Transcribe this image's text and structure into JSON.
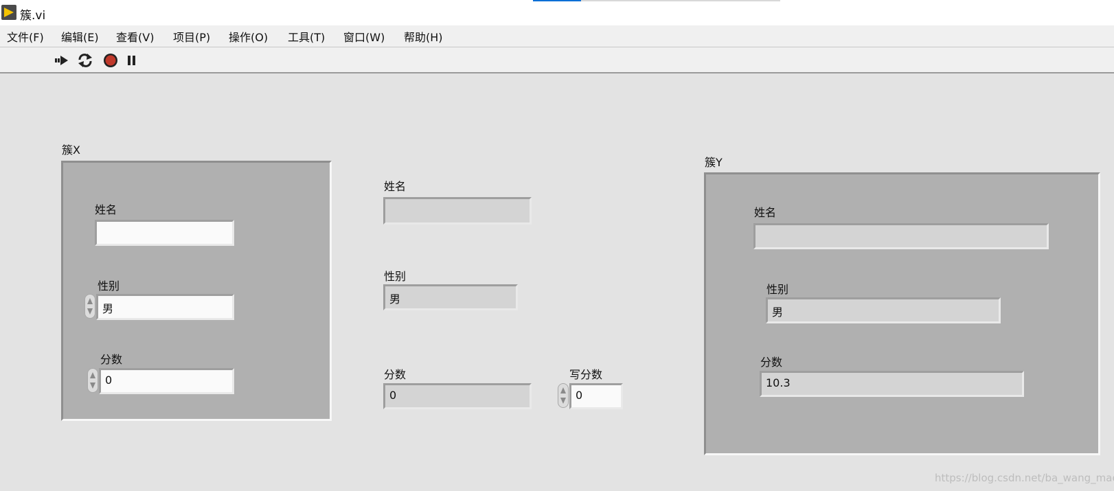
{
  "window": {
    "title": "簇.vi"
  },
  "menu": [
    "文件(F)",
    "编辑(E)",
    "查看(V)",
    "项目(P)",
    "操作(O)",
    "工具(T)",
    "窗口(W)",
    "帮助(H)"
  ],
  "toolbar": {
    "run_icon": "run-arrow-icon",
    "run_continuous_icon": "run-continuously-icon",
    "abort_icon": "abort-stop-icon",
    "pause_icon": "pause-icon"
  },
  "cluster_x": {
    "label": "簇X",
    "name_label": "姓名",
    "name_value": "",
    "gender_label": "性别",
    "gender_value": "男",
    "score_label": "分数",
    "score_value": "0"
  },
  "middle": {
    "name_label": "姓名",
    "name_value": "",
    "gender_label": "性别",
    "gender_value": "男",
    "score_label": "分数",
    "score_value": "0",
    "write_score_label": "写分数",
    "write_score_value": "0"
  },
  "cluster_y": {
    "label": "簇Y",
    "name_label": "姓名",
    "name_value": "",
    "gender_label": "性别",
    "gender_value": "男",
    "score_label": "分数",
    "score_value": "10.3"
  },
  "watermark": "https://blog.csdn.net/ba_wang_mao",
  "colors": {
    "panel_bg": "#e3e3e3",
    "cluster_bg": "#b0b0b0",
    "control_bg": "#fafafa",
    "indicator_bg": "#d4d4d4",
    "abort_red": "#c0392b"
  }
}
